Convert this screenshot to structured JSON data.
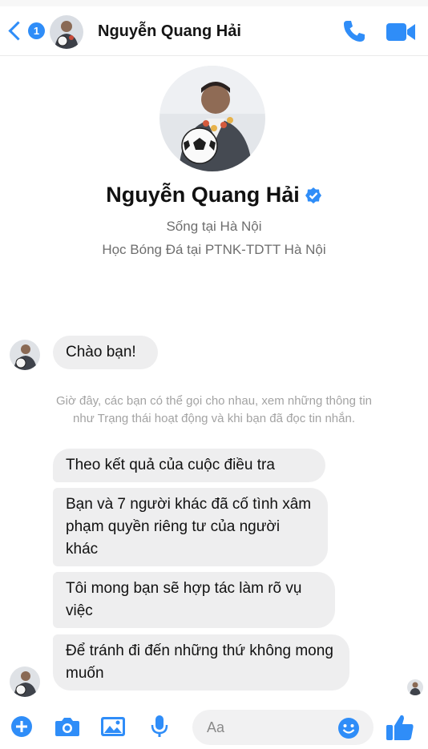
{
  "header": {
    "back_badge": "1",
    "contact_name": "Nguyễn Quang Hải"
  },
  "profile": {
    "name": "Nguyễn Quang Hải",
    "lines": [
      "Sống tại Hà Nội",
      "Học Bóng Đá tại PTNK-TDTT Hà Nội"
    ]
  },
  "messages": {
    "greeting": "Chào bạn!",
    "notice": [
      "Giờ đây, các bạn có thể gọi cho nhau, xem những thông tin",
      "như Trạng thái hoạt động và khi bạn đã đọc tin nhắn."
    ],
    "bubbles": [
      "Theo kết quả của cuộc điều tra",
      "Bạn và 7 người khác đã cố tình xâm phạm quyền riêng tư của người khác",
      "Tôi mong bạn sẽ hợp tác làm rõ vụ việc",
      "Để tránh đi đến những thứ không mong muốn"
    ]
  },
  "composer": {
    "placeholder": "Aa"
  },
  "colors": {
    "accent": "#2f8df8",
    "bubble": "#eeeeef",
    "notice_text": "#a3a3a3"
  },
  "icons": [
    "back-chevron-icon",
    "phone-icon",
    "video-camera-icon",
    "verified-badge-icon",
    "plus-icon",
    "camera-icon",
    "image-icon",
    "microphone-icon",
    "emoji-icon",
    "thumbs-up-icon"
  ]
}
